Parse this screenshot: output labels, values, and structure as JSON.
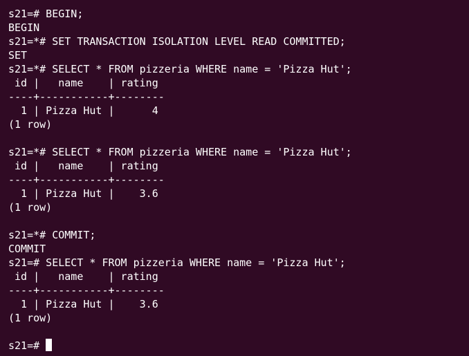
{
  "terminal": {
    "lines": [
      "s21=# BEGIN;",
      "BEGIN",
      "s21=*# SET TRANSACTION ISOLATION LEVEL READ COMMITTED;",
      "SET",
      "s21=*# SELECT * FROM pizzeria WHERE name = 'Pizza Hut';",
      " id |   name    | rating",
      "----+-----------+--------",
      "  1 | Pizza Hut |      4",
      "(1 row)",
      "",
      "s21=*# SELECT * FROM pizzeria WHERE name = 'Pizza Hut';",
      " id |   name    | rating",
      "----+-----------+--------",
      "  1 | Pizza Hut |    3.6",
      "(1 row)",
      "",
      "s21=*# COMMIT;",
      "COMMIT",
      "s21=# SELECT * FROM pizzeria WHERE name = 'Pizza Hut';",
      " id |   name    | rating",
      "----+-----------+--------",
      "  1 | Pizza Hut |    3.6",
      "(1 row)",
      ""
    ],
    "prompt": "s21=# ",
    "cursor_char": ""
  }
}
